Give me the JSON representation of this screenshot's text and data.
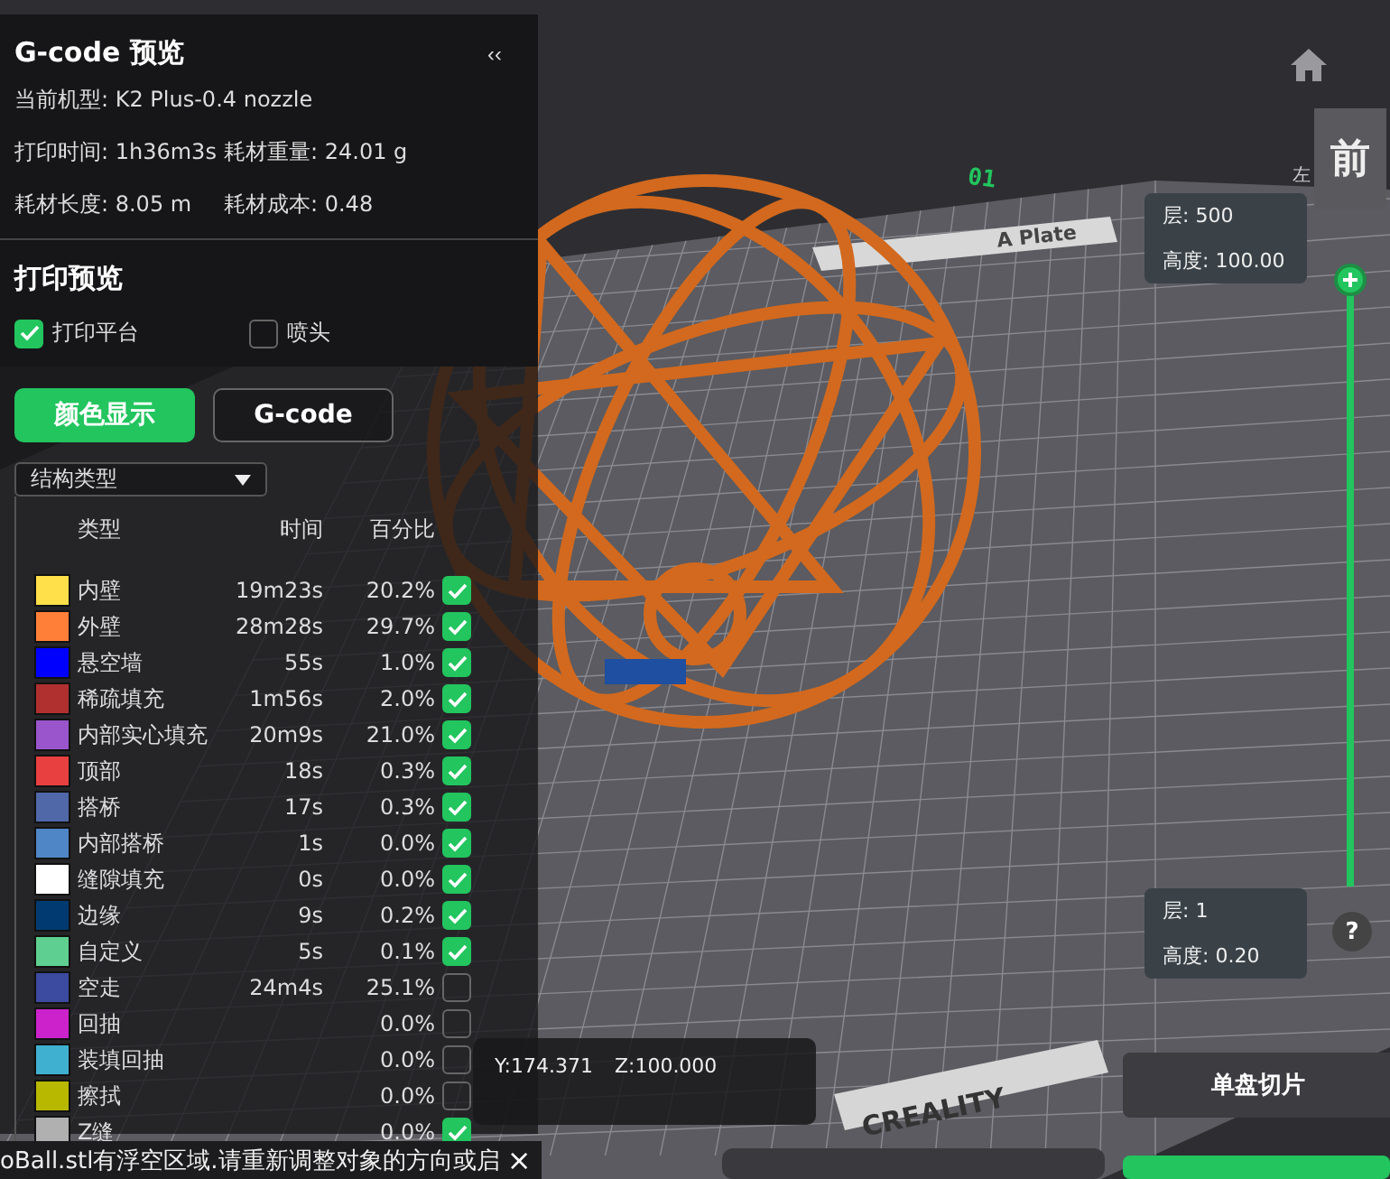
{
  "panel": {
    "title": "G-code 预览",
    "collapse": "‹‹",
    "machine": "当前机型: K2 Plus-0.4 nozzle",
    "stats": [
      {
        "text": "打印时间: 1h36m3s"
      },
      {
        "text": "耗材重量: 24.01 g"
      },
      {
        "text": "耗材长度: 8.05 m"
      },
      {
        "text": "耗材成本: 0.48"
      }
    ]
  },
  "preview": {
    "title": "打印预览",
    "options": [
      {
        "label": "打印平台",
        "checked": true
      },
      {
        "label": "喷头",
        "checked": false
      }
    ]
  },
  "mode_tabs": [
    {
      "label": "颜色显示",
      "selected": true
    },
    {
      "label": "G-code",
      "selected": false
    }
  ],
  "view_select": {
    "value": "结构类型"
  },
  "legend": {
    "columns": [
      "类型",
      "时间",
      "百分比"
    ],
    "rows": [
      {
        "name": "内壁",
        "time": "19m23s",
        "percent": "20.2%",
        "color": "#ffe04a",
        "checked": true
      },
      {
        "name": "外壁",
        "time": "28m28s",
        "percent": "29.7%",
        "color": "#ff7f38",
        "checked": true
      },
      {
        "name": "悬空墙",
        "time": "55s",
        "percent": "1.0%",
        "color": "#0000ff",
        "checked": true
      },
      {
        "name": "稀疏填充",
        "time": "1m56s",
        "percent": "2.0%",
        "color": "#b03030",
        "checked": true
      },
      {
        "name": "内部实心填充",
        "time": "20m9s",
        "percent": "21.0%",
        "color": "#9a55cc",
        "checked": true
      },
      {
        "name": "顶部",
        "time": "18s",
        "percent": "0.3%",
        "color": "#e84040",
        "checked": true
      },
      {
        "name": "搭桥",
        "time": "17s",
        "percent": "0.3%",
        "color": "#5068a8",
        "checked": true
      },
      {
        "name": "内部搭桥",
        "time": "1s",
        "percent": "0.0%",
        "color": "#4f86c6",
        "checked": true
      },
      {
        "name": "缝隙填充",
        "time": "0s",
        "percent": "0.0%",
        "color": "#ffffff",
        "checked": true
      },
      {
        "name": "边缘",
        "time": "9s",
        "percent": "0.2%",
        "color": "#003a70",
        "checked": true
      },
      {
        "name": "自定义",
        "time": "5s",
        "percent": "0.1%",
        "color": "#5ecf90",
        "checked": true
      },
      {
        "name": "空走",
        "time": "24m4s",
        "percent": "25.1%",
        "color": "#3c4aa0",
        "checked": false
      },
      {
        "name": "回抽",
        "percent": "0.0%",
        "color": "#cc22cc",
        "checked": false
      },
      {
        "name": "装填回抽",
        "percent": "0.0%",
        "color": "#40b0d0",
        "checked": false
      },
      {
        "name": "擦拭",
        "percent": "0.0%",
        "color": "#b8b800",
        "checked": false
      },
      {
        "name": "Z缝",
        "percent": "0.0%",
        "color": "#b0b0b0",
        "checked": true
      }
    ]
  },
  "scene": {
    "plate_number": "01",
    "plate_label": "A Plate",
    "brand": "CREALITY"
  },
  "view_cube": {
    "front": "前",
    "left": "左"
  },
  "layer_slider": {
    "level": 1,
    "top": {
      "layer": "层: 500",
      "height": "高度: 100.00"
    },
    "bottom": {
      "layer": "层: 1",
      "height": "高度: 0.20"
    }
  },
  "help": "?",
  "coords": [
    "Y:174.371",
    "Z:100.000"
  ],
  "slice_button": "单盘切片",
  "notification": {
    "text": "oBall.stl有浮空区域.请重新调整对象的方向或启",
    "close": "×"
  }
}
